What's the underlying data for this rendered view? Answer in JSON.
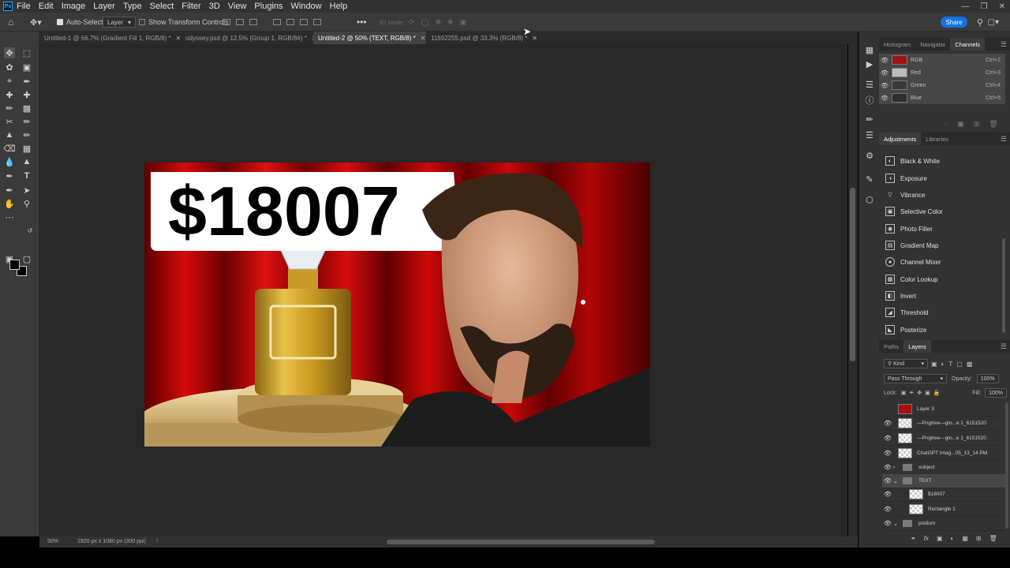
{
  "app": {
    "logo": "Ps"
  },
  "menu": [
    "File",
    "Edit",
    "Image",
    "Layer",
    "Type",
    "Select",
    "Filter",
    "3D",
    "View",
    "Plugins",
    "Window",
    "Help"
  ],
  "options_bar": {
    "auto_select_label": "Auto-Select:",
    "auto_select_value": "Layer",
    "transform_label": "Show Transform Controls",
    "mode_3d": "3D Mode:",
    "share_label": "Share"
  },
  "tabs": [
    {
      "label": "Untitled-1 @ 66.7% (Gradient Fill 1, RGB/8) *",
      "active": false
    },
    {
      "label": "odyssey.psd @ 12.5% (Group 1, RGB/8#) *",
      "active": false
    },
    {
      "label": "Untitled-2 @ 50% (TEXT, RGB/8) *",
      "active": true
    },
    {
      "label": "11692255.psd @ 33.3% (RGB/8) *",
      "active": false
    }
  ],
  "canvas": {
    "headline": "$18007"
  },
  "status": {
    "zoom": "50%",
    "doc_info": "1920 px x 1080 px (300 ppi)"
  },
  "channels_panel": {
    "tabs": [
      "Histogram",
      "Navigator",
      "Channels"
    ],
    "active_tab": "Channels",
    "rows": [
      {
        "name": "RGB",
        "shortcut": "Ctrl+2"
      },
      {
        "name": "Red",
        "shortcut": "Ctrl+3"
      },
      {
        "name": "Green",
        "shortcut": "Ctrl+4"
      },
      {
        "name": "Blue",
        "shortcut": "Ctrl+5"
      }
    ]
  },
  "adjustments_panel": {
    "tabs": [
      "Adjustments",
      "Libraries"
    ],
    "items": [
      "Black & White",
      "Exposure",
      "Vibrance",
      "Selective Color",
      "Photo Filter",
      "Gradient Map",
      "Channel Mixer",
      "Color Lookup",
      "Invert",
      "Threshold",
      "Posterize"
    ]
  },
  "layers_panel": {
    "tabs": [
      "Paths",
      "Layers"
    ],
    "filter_kind": "Kind",
    "blend_mode": "Pass Through",
    "opacity_label": "Opacity:",
    "opacity_value": "100%",
    "lock_label": "Lock:",
    "fill_label": "Fill:",
    "fill_value": "100%",
    "layers": [
      {
        "name": "Layer 3",
        "type": "image",
        "visible": false,
        "indent": 0,
        "selected": false
      },
      {
        "name": "—Pngtree—glo...e 1_6151520",
        "type": "smart",
        "visible": true,
        "indent": 0,
        "selected": false
      },
      {
        "name": "—Pngtree—glo...e 1_6151520",
        "type": "smart",
        "visible": true,
        "indent": 0,
        "selected": false
      },
      {
        "name": "ChatGPT Imag...05_13_14 PM",
        "type": "smart",
        "visible": true,
        "indent": 0,
        "selected": false
      },
      {
        "name": "subject",
        "type": "group",
        "visible": true,
        "indent": 0,
        "selected": false
      },
      {
        "name": "TEXT",
        "type": "group-open",
        "visible": true,
        "indent": 0,
        "selected": true
      },
      {
        "name": "$18007",
        "type": "smart",
        "visible": true,
        "indent": 1,
        "selected": false
      },
      {
        "name": "Rectangle 1",
        "type": "smart",
        "visible": true,
        "indent": 1,
        "selected": false
      },
      {
        "name": "podium",
        "type": "group-open",
        "visible": true,
        "indent": 0,
        "selected": false
      }
    ]
  },
  "colors": {
    "accent": "#1473e6",
    "curtain": "#a50000"
  }
}
